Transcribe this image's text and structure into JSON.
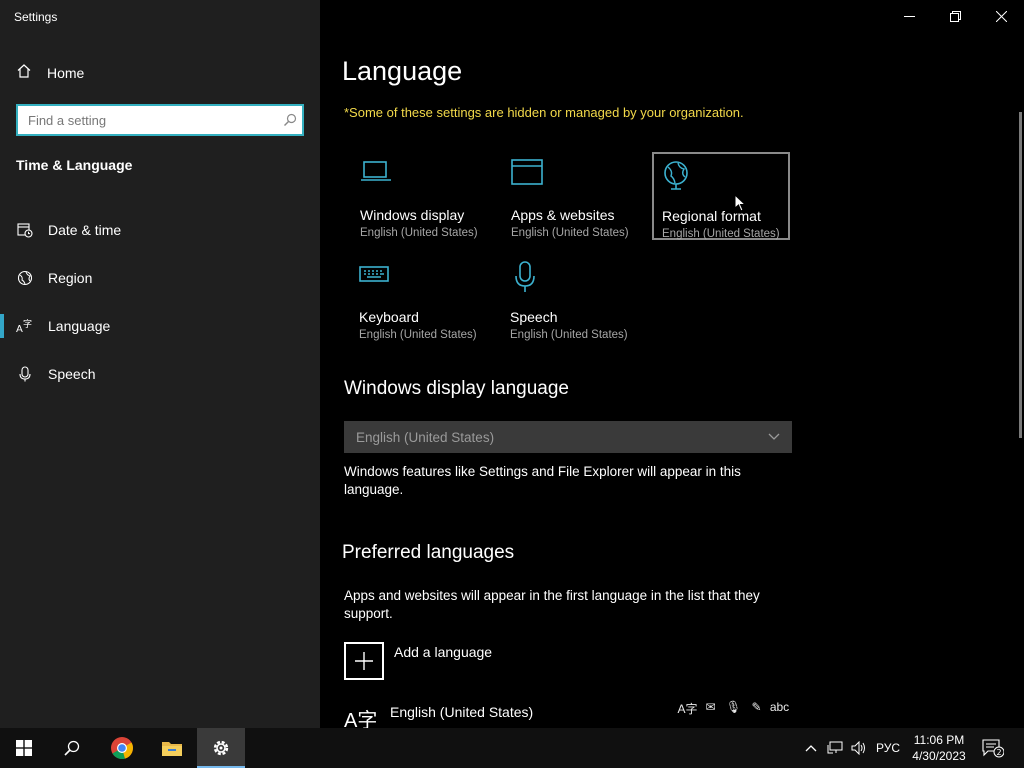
{
  "window": {
    "title": "Settings"
  },
  "sidebar": {
    "home_label": "Home",
    "search_placeholder": "Find a setting",
    "section_title": "Time & Language",
    "items": [
      {
        "label": "Date & time",
        "icon": "calendar-clock-icon"
      },
      {
        "label": "Region",
        "icon": "globe-icon"
      },
      {
        "label": "Language",
        "icon": "language-icon",
        "active": true
      },
      {
        "label": "Speech",
        "icon": "microphone-icon"
      }
    ]
  },
  "main": {
    "title": "Language",
    "managed_notice": "*Some of these settings are hidden or managed by your organization.",
    "tiles": [
      {
        "title": "Windows display",
        "subtitle": "English (United States)",
        "icon": "laptop-icon"
      },
      {
        "title": "Apps & websites",
        "subtitle": "English (United States)",
        "icon": "browser-window-icon"
      },
      {
        "title": "Regional format",
        "subtitle": "English (United States)",
        "icon": "globe-icon"
      },
      {
        "title": "Keyboard",
        "subtitle": "English (United States)",
        "icon": "keyboard-icon"
      },
      {
        "title": "Speech",
        "subtitle": "English (United States)",
        "icon": "microphone-icon"
      }
    ],
    "display_language": {
      "heading": "Windows display language",
      "dropdown_value": "English (United States)",
      "description": "Windows features like Settings and File Explorer will appear in this language."
    },
    "preferred": {
      "heading": "Preferred languages",
      "description": "Apps and websites will appear in the first language in the list that they support.",
      "add_label": "Add a language",
      "languages": [
        {
          "name": "English (United States)",
          "glyph": "A字"
        }
      ],
      "feature_glyphs": [
        "A字",
        "✉",
        "🎙",
        "✎",
        "abc"
      ]
    }
  },
  "taskbar": {
    "tray_language": "РУС",
    "time": "11:06 PM",
    "date": "4/30/2023",
    "notification_count": "2",
    "icons": [
      "windows-start-icon",
      "search-icon",
      "chrome-icon",
      "file-explorer-icon",
      "settings-gear-icon"
    ]
  },
  "colors": {
    "accent": "#33a6c8",
    "warning": "#f2d94a",
    "sidebar_bg": "#1f1f1f",
    "main_bg": "#000000"
  }
}
